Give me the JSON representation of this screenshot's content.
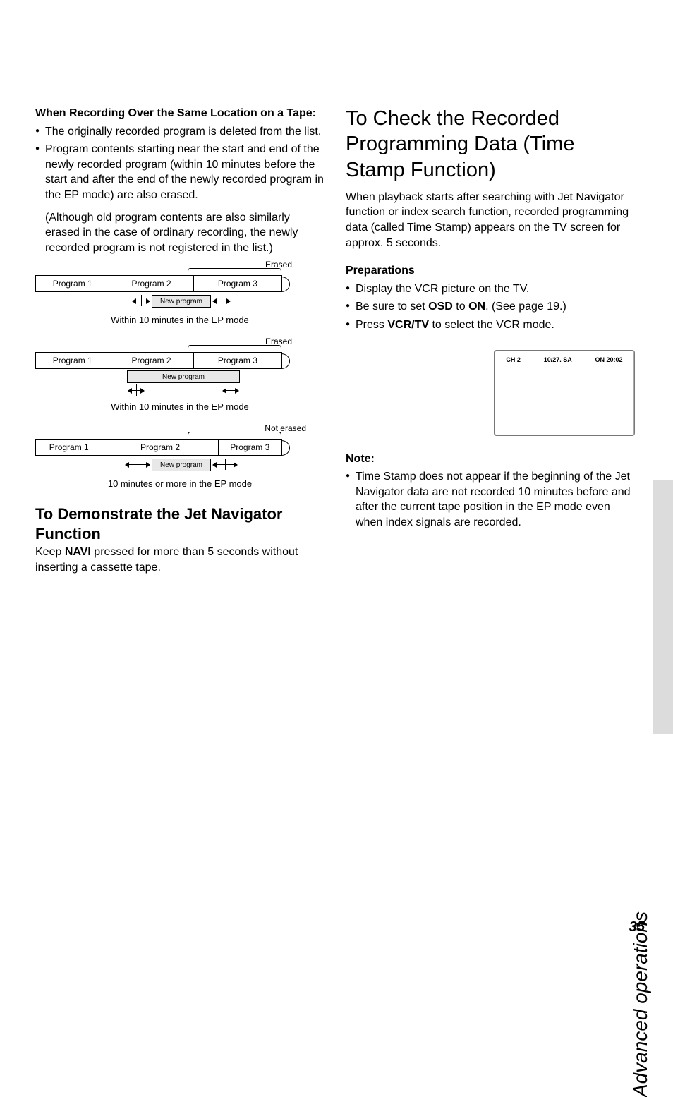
{
  "left": {
    "heading": "When Recording Over the Same Location on a Tape:",
    "bullet1": "The originally recorded program is deleted from the list.",
    "bullet2": "Program contents starting near the start and end of the newly recorded program (within 10 minutes before the start and after the end of the newly recorded program in the EP mode) are also erased.",
    "paren": "(Although old program contents are also similarly erased in the case of ordinary recording, the newly recorded program is not registered in the list.)",
    "diagram": {
      "program1": "Program 1",
      "program2": "Program 2",
      "program3": "Program 3",
      "erased": "Erased",
      "not_erased": "Not erased",
      "new_program": "New program",
      "caption_10min": "Within 10 minutes in the EP mode",
      "caption_10more": "10 minutes or more in the EP mode"
    },
    "demo_heading": "To Demonstrate the Jet Navigator Function",
    "demo_text_pre": "Keep ",
    "demo_text_bold": "NAVI",
    "demo_text_post": " pressed for more than 5 seconds without inserting a cassette tape."
  },
  "right": {
    "title": "To Check the Recorded Programming Data (Time Stamp Function)",
    "intro": "When playback starts after searching with Jet Navigator function or index search function, recorded programming data (called Time Stamp) appears on the TV screen for approx. 5 seconds.",
    "prep_heading": "Preparations",
    "prep1": "Display the VCR picture on the TV.",
    "prep2_pre": "Be sure to set ",
    "prep2_b1": "OSD",
    "prep2_mid": " to ",
    "prep2_b2": "ON",
    "prep2_post": ". (See page 19.)",
    "prep3_pre": "Press ",
    "prep3_b": "VCR/TV",
    "prep3_post": " to select the VCR mode.",
    "tv": {
      "ch": "CH 2",
      "date": "10/27. SA",
      "time": "ON 20:02"
    },
    "note_heading": "Note:",
    "note_text": "Time Stamp does not appear if the beginning of the Jet Navigator data are not recorded 10 minutes before and after the current tape position in the EP mode even when index signals are recorded."
  },
  "side_label": "Advanced operations",
  "page_num": "35"
}
